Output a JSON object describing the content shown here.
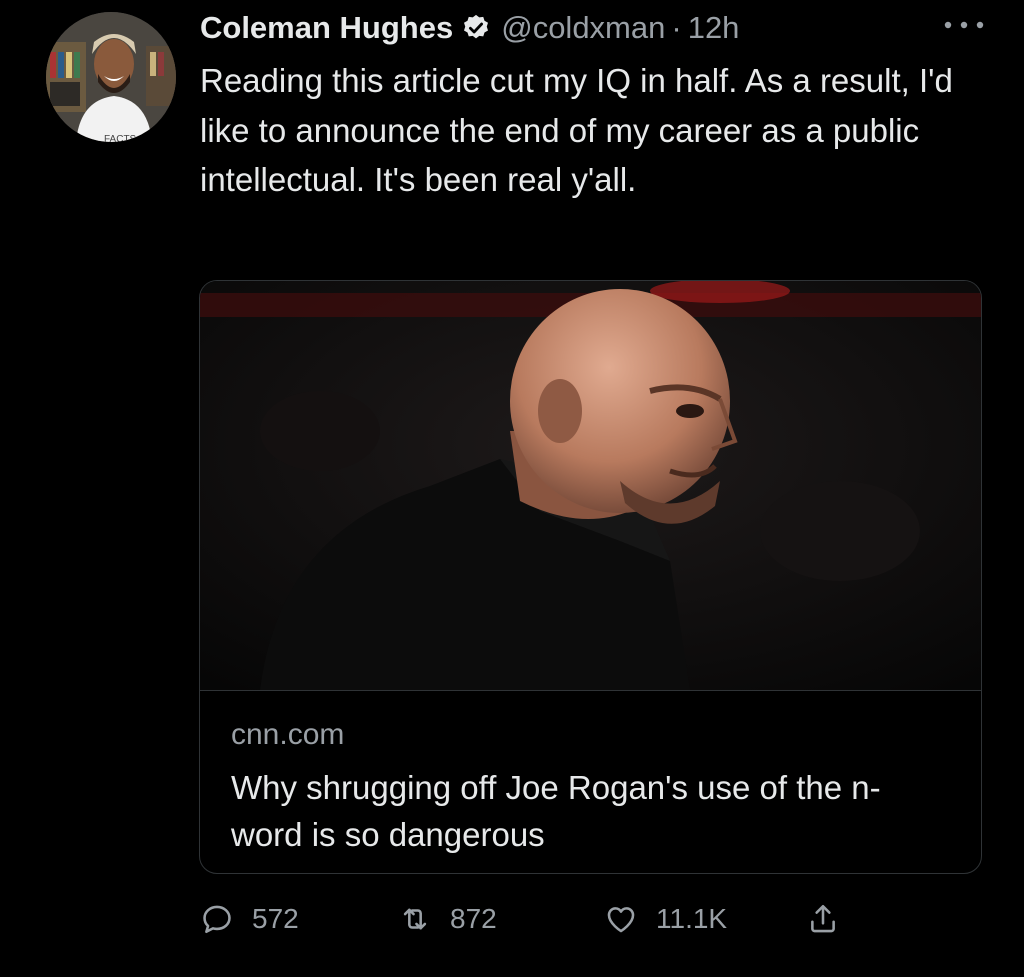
{
  "tweet": {
    "author_name": "Coleman Hughes",
    "handle": "@coldxman",
    "separator": "·",
    "time": "12h",
    "verified": true,
    "text": "Reading this article cut my IQ in half. As a result, I'd like to announce the end of my career as a public intellectual. It's been real y'all."
  },
  "avatar": {
    "shirt_text": "FACTS"
  },
  "card": {
    "domain": "cnn.com",
    "title": "Why shrugging off Joe Rogan's use of the n-word is so dangerous"
  },
  "actions": {
    "replies": "572",
    "retweets": "872",
    "likes": "11.1K"
  },
  "icons": {
    "reply": "reply-icon",
    "retweet": "retweet-icon",
    "like": "heart-icon",
    "share": "share-icon",
    "more": "more-icon",
    "verified": "verified-badge-icon"
  },
  "colors": {
    "background": "#000000",
    "text": "#e7e9ea",
    "secondary": "#9aa0a6",
    "border": "#2f3336"
  }
}
